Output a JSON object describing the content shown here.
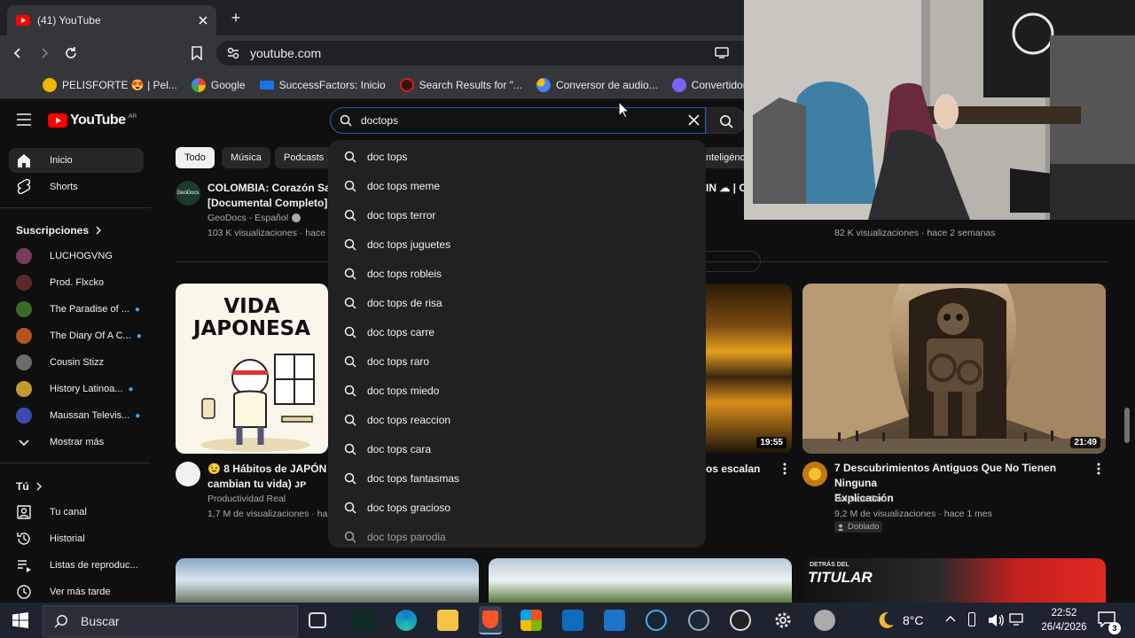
{
  "browser": {
    "tab_title": "(41) YouTube",
    "url": "youtube.com",
    "bookmarks": [
      {
        "label": "PELISFORTE 😍 | Pel...",
        "icon": "pelisforte-icon",
        "color": "#f4b400"
      },
      {
        "label": "Google",
        "icon": "google-icon",
        "color": "#4285f4"
      },
      {
        "label": "SuccessFactors: Inicio",
        "icon": "sap-icon",
        "color": "#1a73e8"
      },
      {
        "label": "Search Results for \"...",
        "icon": "search-results-icon",
        "color": "#c5221f"
      },
      {
        "label": "Conversor de audio...",
        "icon": "conversor-icon",
        "color": "#fbbc04"
      },
      {
        "label": "Convertidor de",
        "icon": "convertidor-icon",
        "color": "#7b61ff"
      }
    ]
  },
  "youtube": {
    "logo": "YouTube",
    "country": "AR",
    "search": {
      "value": "doctops",
      "suggestions": [
        "doc tops",
        "doc tops meme",
        "doc tops terror",
        "doc tops juguetes",
        "doc tops robleis",
        "doc tops de risa",
        "doc tops carre",
        "doc tops raro",
        "doc tops miedo",
        "doc tops reaccion",
        "doc tops cara",
        "doc tops fantasmas",
        "doc tops gracioso",
        "doc tops parodia"
      ]
    },
    "sidebar": {
      "main": [
        {
          "label": "Inicio",
          "icon": "home-icon"
        },
        {
          "label": "Shorts",
          "icon": "shorts-icon"
        }
      ],
      "subs_header": "Suscripciones",
      "subscriptions": [
        {
          "label": "LUCHOGVNG",
          "color": "#7a3b5c",
          "new": false
        },
        {
          "label": "Prod. Flxcko",
          "color": "#5a2a2a",
          "new": false
        },
        {
          "label": "The Paradise of ...",
          "color": "#3b6b2a",
          "new": true
        },
        {
          "label": "The Diary Of A C...",
          "color": "#b3541e",
          "new": true
        },
        {
          "label": "Cousin Stizz",
          "color": "#6b6b6b",
          "new": false
        },
        {
          "label": "History Latinoa...",
          "color": "#c49a2a",
          "new": true
        },
        {
          "label": "Maussan Televis...",
          "color": "#3b4bb3",
          "new": true
        }
      ],
      "more": "Mostrar más",
      "you_header": "Tú",
      "you": [
        {
          "label": "Tu canal",
          "icon": "channel-icon"
        },
        {
          "label": "Historial",
          "icon": "history-icon"
        },
        {
          "label": "Listas de reproduc...",
          "icon": "playlists-icon"
        },
        {
          "label": "Ver más tarde",
          "icon": "watch-later-icon"
        }
      ]
    },
    "chips": [
      "Todo",
      "Música",
      "Podcasts"
    ],
    "chip_right": "nteligénc",
    "top_row": {
      "left_title_1": "COLOMBIA: Corazón Salv",
      "left_title_2": "[Documental Completo]",
      "left_channel": "GeoDocs - Español",
      "left_meta": "103 K visualizaciones · hace",
      "right_partial": "IN ☁ | C",
      "right_meta": "82 K visualizaciones · hace 2 semanas"
    },
    "videos": [
      {
        "thumb_text_1": "VIDA",
        "thumb_text_2": "JAPONESA",
        "title_1": "😉 8 Hábitos de JAPÓN q",
        "title_2": "cambian tu vida) ᴊᴘ",
        "channel": "Productividad Real",
        "meta": "1,7 M de visualizaciones · ha"
      },
      {
        "duration": "19:55",
        "title_partial": "os escalan"
      },
      {
        "duration": "21:49",
        "title_1": "7 Descubrimientos Antiguos Que No Tienen Ninguna",
        "title_2": "Explicación",
        "channel": "Science Sun",
        "meta": "9,2 M de visualizaciones · hace 1 mes",
        "badge": "Doblado"
      }
    ],
    "bottom_thumb_text": "TITULAR",
    "bottom_thumb_text_small": "DETRÁS DEL"
  },
  "taskbar": {
    "search_placeholder": "Buscar",
    "temperature": "8°C",
    "time": "22:52",
    "date": "26/4/2026",
    "notifications": "3"
  }
}
